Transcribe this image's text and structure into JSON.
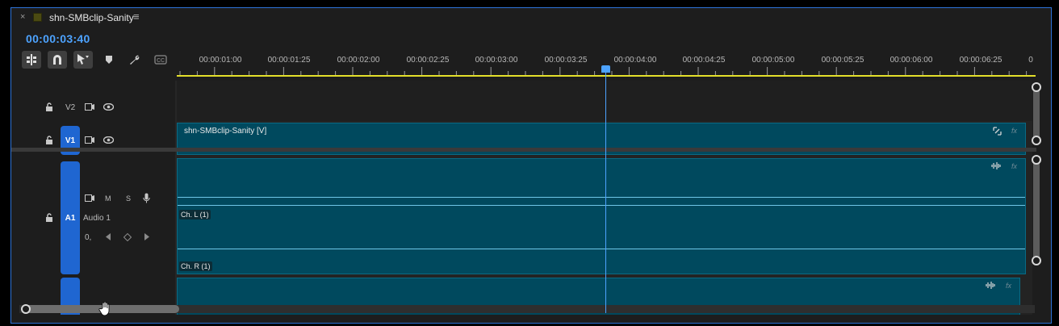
{
  "tab": {
    "close": "×",
    "title": "shn-SMBclip-Sanity",
    "menu": "≡"
  },
  "timecode": "00:00:03:40",
  "ruler": {
    "labels": [
      "00:00:01:00",
      "00:00:01:25",
      "00:00:02:00",
      "00:00:02:25",
      "00:00:03:00",
      "00:00:03:25",
      "00:00:04:00",
      "00:00:04:25",
      "00:00:05:00",
      "00:00:05:25",
      "00:00:06:00",
      "00:00:06:25",
      "0"
    ]
  },
  "tracks": {
    "v2": {
      "name": "V2"
    },
    "v1": {
      "name": "V1"
    },
    "a1": {
      "name": "A1",
      "label": "Audio 1",
      "mute": "M",
      "solo": "S",
      "keyframe_label": "0,"
    }
  },
  "clips": {
    "video": {
      "name": "shn-SMBclip-Sanity [V]",
      "fx": "fx"
    },
    "audio": {
      "ch_l": "Ch. L (1)",
      "ch_r": "Ch. R (1)",
      "fx": "fx"
    },
    "audio2": {
      "fx": "fx"
    }
  },
  "colors": {
    "accent": "#4da3ff",
    "track_target": "#1f66d1",
    "clip": "#00495e",
    "ruler_work_area": "#e3df2a"
  },
  "icons": [
    "insert-edit-icon",
    "snap-magnet-icon",
    "linked-selection-icon",
    "marker-icon",
    "wrench-icon",
    "captions-icon",
    "lock-icon",
    "film-icon",
    "eye-icon",
    "microphone-icon",
    "keyframe-icon"
  ]
}
